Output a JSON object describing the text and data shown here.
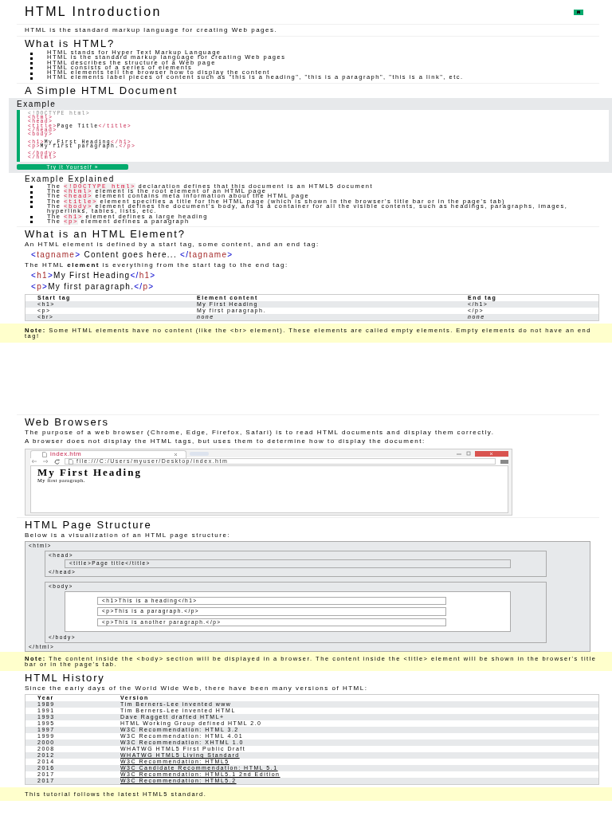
{
  "title": "HTML Introduction",
  "intro": "HTML is the standard markup language for creating Web pages.",
  "what_is": {
    "heading": "What is HTML?",
    "items": [
      "HTML stands for Hyper Text Markup Language",
      "HTML is the standard markup language for creating Web pages",
      "HTML describes the structure of a Web page",
      "HTML consists of a series of elements",
      "HTML elements tell the browser how to display the content",
      "HTML elements label pieces of content such as \"this is a heading\", \"this is a paragraph\", \"this is a link\", etc."
    ]
  },
  "simple_doc": {
    "heading": "A Simple HTML Document",
    "example_label": "Example",
    "code_blocks": [
      [
        [
          {
            "kind": "doctype",
            "text": "<!DOCTYPE html>"
          }
        ],
        [
          {
            "kind": "tag",
            "text": "<html>"
          }
        ],
        [
          {
            "kind": "tag",
            "text": "<head>"
          }
        ],
        [
          {
            "kind": "tag",
            "text": "<title>"
          },
          {
            "kind": "text",
            "text": "Page Title"
          },
          {
            "kind": "tag",
            "text": "</title>"
          }
        ],
        [
          {
            "kind": "tag",
            "text": "</head>"
          }
        ],
        [
          {
            "kind": "tag",
            "text": "<body>"
          }
        ]
      ],
      [
        [
          {
            "kind": "tag",
            "text": "<h1>"
          },
          {
            "kind": "text",
            "text": "My First Heading"
          },
          {
            "kind": "tag",
            "text": "</h1>"
          }
        ],
        [
          {
            "kind": "tag",
            "text": "<p>"
          },
          {
            "kind": "text",
            "text": "My first paragraph."
          },
          {
            "kind": "tag",
            "text": "</p>"
          }
        ]
      ],
      [
        [
          {
            "kind": "tag",
            "text": "</body>"
          }
        ],
        [
          {
            "kind": "tag",
            "text": "</html>"
          }
        ]
      ]
    ],
    "button": "Try it Yourself »"
  },
  "explained": {
    "heading": "Example Explained",
    "items": [
      [
        {
          "kind": "text",
          "text": "The "
        },
        {
          "kind": "code",
          "text": "<!DOCTYPE html>"
        },
        {
          "kind": "text",
          "text": " declaration defines that this document is an HTML5 document"
        }
      ],
      [
        {
          "kind": "text",
          "text": "The "
        },
        {
          "kind": "code",
          "text": "<html>"
        },
        {
          "kind": "text",
          "text": " element is the root element of an HTML page"
        }
      ],
      [
        {
          "kind": "text",
          "text": "The "
        },
        {
          "kind": "code",
          "text": "<head>"
        },
        {
          "kind": "text",
          "text": " element contains meta information about the HTML page"
        }
      ],
      [
        {
          "kind": "text",
          "text": "The "
        },
        {
          "kind": "code",
          "text": "<title>"
        },
        {
          "kind": "text",
          "text": " element specifies a title for the HTML page (which is shown in the browser's title bar or in the page's tab)"
        }
      ],
      [
        {
          "kind": "text",
          "text": "The "
        },
        {
          "kind": "code",
          "text": "<body>"
        },
        {
          "kind": "text",
          "text": " element defines the document's body, and is a container for all the visible contents, such as headings, paragraphs, images, hyperlinks, tables, lists, etc."
        }
      ],
      [
        {
          "kind": "text",
          "text": "The "
        },
        {
          "kind": "code",
          "text": "<h1>"
        },
        {
          "kind": "text",
          "text": " element defines a large heading"
        }
      ],
      [
        {
          "kind": "text",
          "text": "The "
        },
        {
          "kind": "code",
          "text": "<p>"
        },
        {
          "kind": "text",
          "text": " element defines a paragraph"
        }
      ]
    ]
  },
  "element": {
    "heading": "What is an HTML Element?",
    "content": [
      {
        "kind": "paragraph",
        "text": "An HTML element is defined by a start tag, some content, and an end tag:"
      },
      {
        "kind": "code",
        "segments": [
          {
            "kind": "bracket",
            "text": "<"
          },
          {
            "kind": "name",
            "text": "tagname"
          },
          {
            "kind": "bracket",
            "text": ">"
          },
          {
            "kind": "text",
            "text": " Content goes here... "
          },
          {
            "kind": "bracket",
            "text": "</"
          },
          {
            "kind": "name",
            "text": "tagname"
          },
          {
            "kind": "bracket",
            "text": ">"
          }
        ]
      },
      {
        "kind": "paragraph",
        "text": "The HTML **element** is everything from the start tag to the end tag:"
      },
      {
        "kind": "code",
        "segments": [
          {
            "kind": "bracket",
            "text": "<"
          },
          {
            "kind": "name",
            "text": "h1"
          },
          {
            "kind": "bracket",
            "text": ">"
          },
          {
            "kind": "text",
            "text": "My First Heading"
          },
          {
            "kind": "bracket",
            "text": "</"
          },
          {
            "kind": "name",
            "text": "h1"
          },
          {
            "kind": "bracket",
            "text": ">"
          }
        ]
      },
      {
        "kind": "code",
        "segments": [
          {
            "kind": "bracket",
            "text": "<"
          },
          {
            "kind": "name",
            "text": "p"
          },
          {
            "kind": "bracket",
            "text": ">"
          },
          {
            "kind": "text",
            "text": "My first paragraph."
          },
          {
            "kind": "bracket",
            "text": "</"
          },
          {
            "kind": "name",
            "text": "p"
          },
          {
            "kind": "bracket",
            "text": ">"
          }
        ]
      }
    ],
    "table": {
      "columns": [
        "Start tag",
        "Element content",
        "End tag"
      ],
      "rows": [
        [
          {
            "kind": "plain",
            "text": "<h1>"
          },
          {
            "kind": "plain",
            "text": "My First Heading"
          },
          {
            "kind": "plain",
            "text": "</h1>"
          }
        ],
        [
          {
            "kind": "plain",
            "text": "<p>"
          },
          {
            "kind": "plain",
            "text": "My first paragraph."
          },
          {
            "kind": "plain",
            "text": "</p>"
          }
        ],
        [
          {
            "kind": "plain",
            "text": "<br>"
          },
          {
            "kind": "empty",
            "text": "none"
          },
          {
            "kind": "empty",
            "text": "none"
          }
        ]
      ]
    },
    "note": "**Note:** Some HTML elements have no content (like the <br> element). These elements are called empty elements. Empty elements do not have an end tag!"
  },
  "browsers": {
    "heading": "Web Browsers",
    "paragraphs": [
      "The purpose of a web browser (Chrome, Edge, Firefox, Safari) is to read HTML documents and display them correctly.",
      "A browser does not display the HTML tags, but uses them to determine how to display the document:"
    ],
    "window": {
      "tab": "index.htm",
      "url": "file:///C:/Users/myuser/Desktop/index.htm",
      "heading": "My First Heading",
      "paragraph": "My first paragraph."
    }
  },
  "structure": {
    "heading": "HTML Page Structure",
    "paragraph": "Below is a visualization of an HTML page structure:",
    "tree": {
      "open": "<html>",
      "close": "</html>",
      "children": [
        {
          "open": "<head>",
          "close": "</head>",
          "children": [
            {
              "text": "<title>Page title</title>"
            }
          ]
        },
        {
          "open": "<body>",
          "close": "</body>",
          "children": [
            {
              "children": [
                {
                  "text": "<h1>This is a heading</h1>"
                },
                {
                  "text": "<p>This is a paragraph.</p>"
                },
                {
                  "text": "<p>This is another paragraph.</p>"
                }
              ]
            }
          ]
        }
      ]
    },
    "note": "**Note:** The content inside the <body> section will be displayed in a browser. The content inside the <title> element will be shown in the browser's title bar or in the page's tab."
  },
  "history": {
    "heading": "HTML History",
    "paragraph": "Since the early days of the World Wide Web, there have been many versions of HTML:",
    "columns": [
      "Year",
      "Version"
    ],
    "rows": [
      {
        "year": "1989",
        "version": "Tim Berners-Lee invented www",
        "link": false
      },
      {
        "year": "1991",
        "version": "Tim Berners-Lee invented HTML",
        "link": false
      },
      {
        "year": "1993",
        "version": "Dave Raggett drafted HTML+",
        "link": false
      },
      {
        "year": "1995",
        "version": "HTML Working Group defined HTML 2.0",
        "link": false
      },
      {
        "year": "1997",
        "version": "W3C Recommendation: HTML 3.2",
        "link": false
      },
      {
        "year": "1999",
        "version": "W3C Recommendation: HTML 4.01",
        "link": false
      },
      {
        "year": "2000",
        "version": "W3C Recommendation: XHTML 1.0",
        "link": false
      },
      {
        "year": "2008",
        "version": "WHATWG HTML5 First Public Draft",
        "link": false
      },
      {
        "year": "2012",
        "version": "WHATWG HTML5 Living Standard",
        "link": true
      },
      {
        "year": "2014",
        "version": "W3C Recommendation: HTML5",
        "link": true
      },
      {
        "year": "2016",
        "version": "W3C Candidate Recommendation: HTML 5.1",
        "link": true
      },
      {
        "year": "2017",
        "version": "W3C Recommendation: HTML5.1 2nd Edition",
        "link": true
      },
      {
        "year": "2017",
        "version": "W3C Recommendation: HTML5.2",
        "link": true
      }
    ],
    "note": "This tutorial follows the latest HTML5 standard."
  }
}
